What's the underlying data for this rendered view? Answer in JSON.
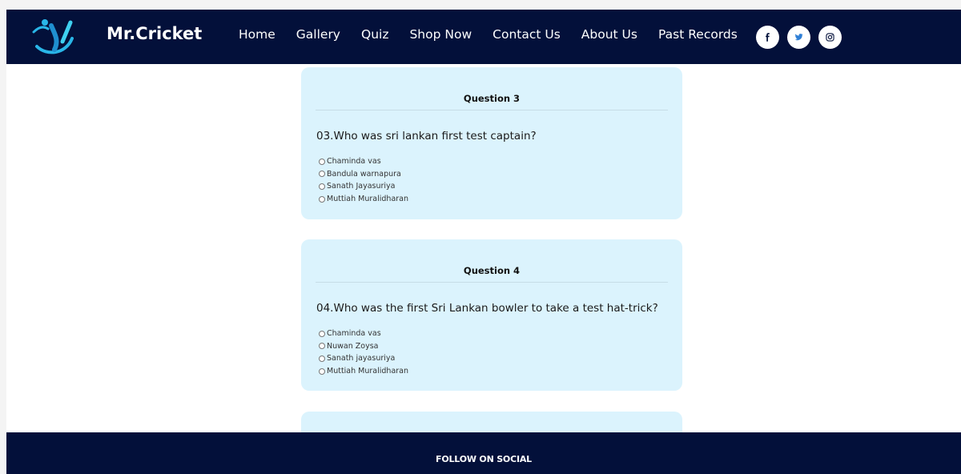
{
  "brand": {
    "name": "Mr.Cricket"
  },
  "nav": {
    "links": [
      "Home",
      "Gallery",
      "Quiz",
      "Shop Now",
      "Contact Us",
      "About Us",
      "Past Records"
    ]
  },
  "social_icons": [
    "facebook-icon",
    "twitter-icon",
    "instagram-icon"
  ],
  "questions": [
    {
      "title": "Question 3",
      "text": "03.Who was sri lankan first test captain?",
      "options": [
        "Chaminda vas",
        "Bandula warnapura",
        "Sanath Jayasuriya",
        "Muttiah Muralidharan"
      ]
    },
    {
      "title": "Question 4",
      "text": "04.Who was the first Sri Lankan bowler to take a test hat-trick?",
      "options": [
        "Chaminda vas",
        "Nuwan Zoysa",
        "Sanath jayasuriya",
        "Muttiah Muralidharan"
      ]
    }
  ],
  "footer": {
    "title": "FOLLOW ON SOCIAL"
  },
  "colors": {
    "navbar": "#03103a",
    "card": "#dbf3fd",
    "logo": "#29b6e8"
  }
}
